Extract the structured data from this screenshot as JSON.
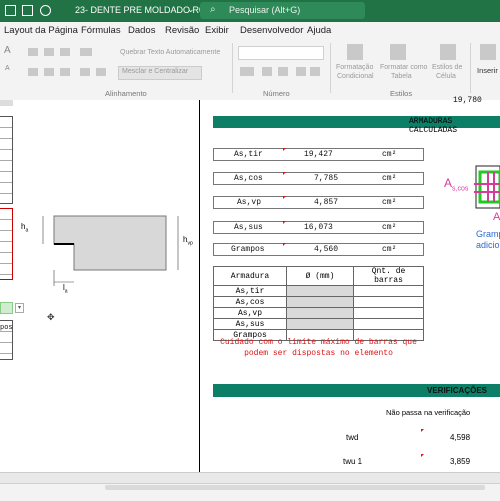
{
  "window": {
    "title": "23- DENTE PRE MOLDADO R0",
    "search_placeholder": "Pesquisar (Alt+G)"
  },
  "menu": [
    "Layout da Página",
    "Fórmulas",
    "Dados",
    "Revisão",
    "Exibir",
    "Desenvolvedor",
    "Ajuda"
  ],
  "ribbon": {
    "wrap_text": "Quebrar Texto Automaticamente",
    "merge_center": "Mesclar e Centralizar",
    "conditional_formatting": [
      "Formatação",
      "Condicional"
    ],
    "format_as_table": [
      "Formatar como",
      "Tabela"
    ],
    "cell_styles": [
      "Estilos de",
      "Célula"
    ],
    "insert": "Inserir",
    "group_alignment": "Alinhamento",
    "group_number": "Número",
    "group_styles": "Estilos",
    "font_size_up": "A",
    "font_size_down": "A"
  },
  "drawing": {
    "label_ha": "h",
    "label_ha_sub": "a",
    "label_hvp": "h",
    "label_hvp_sub": "vp",
    "label_la": "l",
    "label_la_sub": "a"
  },
  "left": {
    "partial_label": "pos"
  },
  "top_partial_value": "19,780",
  "armaduras": {
    "header": "ARMADURAS CALCULADAS",
    "rows": [
      {
        "label": "As,tir",
        "value": "19,427",
        "unit": "cm²"
      },
      {
        "label": "As,cos",
        "value": "7,785",
        "unit": "cm²"
      },
      {
        "label": "As,vp",
        "value": "4,857",
        "unit": "cm²"
      },
      {
        "label": "As,sus",
        "value": "16,073",
        "unit": "cm²"
      },
      {
        "label": "Grampos",
        "value": "4,560",
        "unit": "cm²"
      }
    ]
  },
  "figure": {
    "as_cos_label": "A",
    "as_cos_sub": "s,cos",
    "gramp_text_1": "Gramp",
    "gramp_text_2": "adicio",
    "partial_a": "A"
  },
  "bars_table": {
    "headers": [
      "Armadura",
      "Ø (mm)",
      "Qnt. de barras"
    ],
    "rows": [
      "As,tir",
      "As,cos",
      "As,vp",
      "As,sus",
      "Grampos"
    ]
  },
  "warning": {
    "line1": "Cuidado com o limite máximo de barras que",
    "line2": "podem ser dispostas no elemento"
  },
  "verificacoes": {
    "header": "VERIFICAÇÕES",
    "subtitle": "Não passa na verificação",
    "rows": [
      {
        "label": "twd",
        "value": "4,598"
      },
      {
        "label": "twu 1",
        "value": "3,859"
      }
    ]
  },
  "colors": {
    "excel_green": "#217346",
    "teal_header": "#0d7f67",
    "warning_red": "#e01010",
    "as_cos_pink": "#d43c9c",
    "stirrup_green": "#22c922",
    "gramp_blue": "#2d6ad0"
  }
}
